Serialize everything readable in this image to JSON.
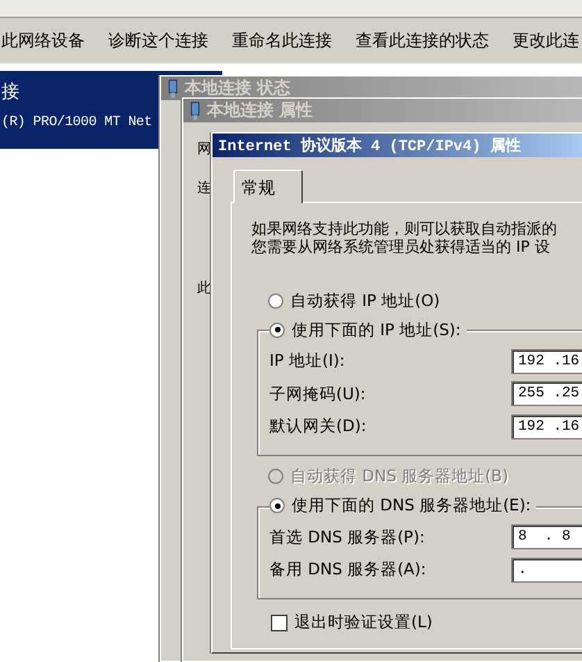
{
  "toolbar": {
    "items": [
      "此网络设备",
      "诊断这个连接",
      "重命名此连接",
      "查看此连接的状态",
      "更改此连"
    ]
  },
  "connections": [
    {
      "name": "接",
      "device": "(R) PRO/1000 MT Net",
      "selected": true
    }
  ],
  "status_window": {
    "title": "本地连接 状态",
    "active": false
  },
  "properties_window": {
    "title": "本地连接 属性",
    "active": false,
    "fragments": [
      "网",
      "连",
      "此"
    ]
  },
  "ipv4_dialog": {
    "title": "Internet 协议版本 4 (TCP/IPv4) 属性",
    "active": true,
    "tabs": [
      {
        "label": "常规",
        "selected": true
      }
    ],
    "description": [
      "如果网络支持此功能，则可以获取自动指派的",
      "您需要从网络系统管理员处获得适当的 IP 设"
    ],
    "ip_auto": {
      "label": "自动获得 IP 地址(O)",
      "selected": false
    },
    "ip_manual": {
      "label": "使用下面的 IP 地址(S):",
      "selected": true
    },
    "ip_fields": [
      {
        "label": "IP 地址(I):",
        "value": "192 .16"
      },
      {
        "label": "子网掩码(U):",
        "value": "255 .25"
      },
      {
        "label": "默认网关(D):",
        "value": "192 .16"
      }
    ],
    "dns_auto": {
      "label": "自动获得 DNS 服务器地址(B)",
      "selected": false,
      "disabled": true
    },
    "dns_manual": {
      "label": "使用下面的 DNS 服务器地址(E):",
      "selected": true
    },
    "dns_fields": [
      {
        "label": "首选 DNS 服务器(P):",
        "value": "8  . 8"
      },
      {
        "label": "备用 DNS 服务器(A):",
        "value": "."
      }
    ],
    "validate_on_exit": {
      "label": "退出时验证设置(L)",
      "checked": false
    }
  }
}
